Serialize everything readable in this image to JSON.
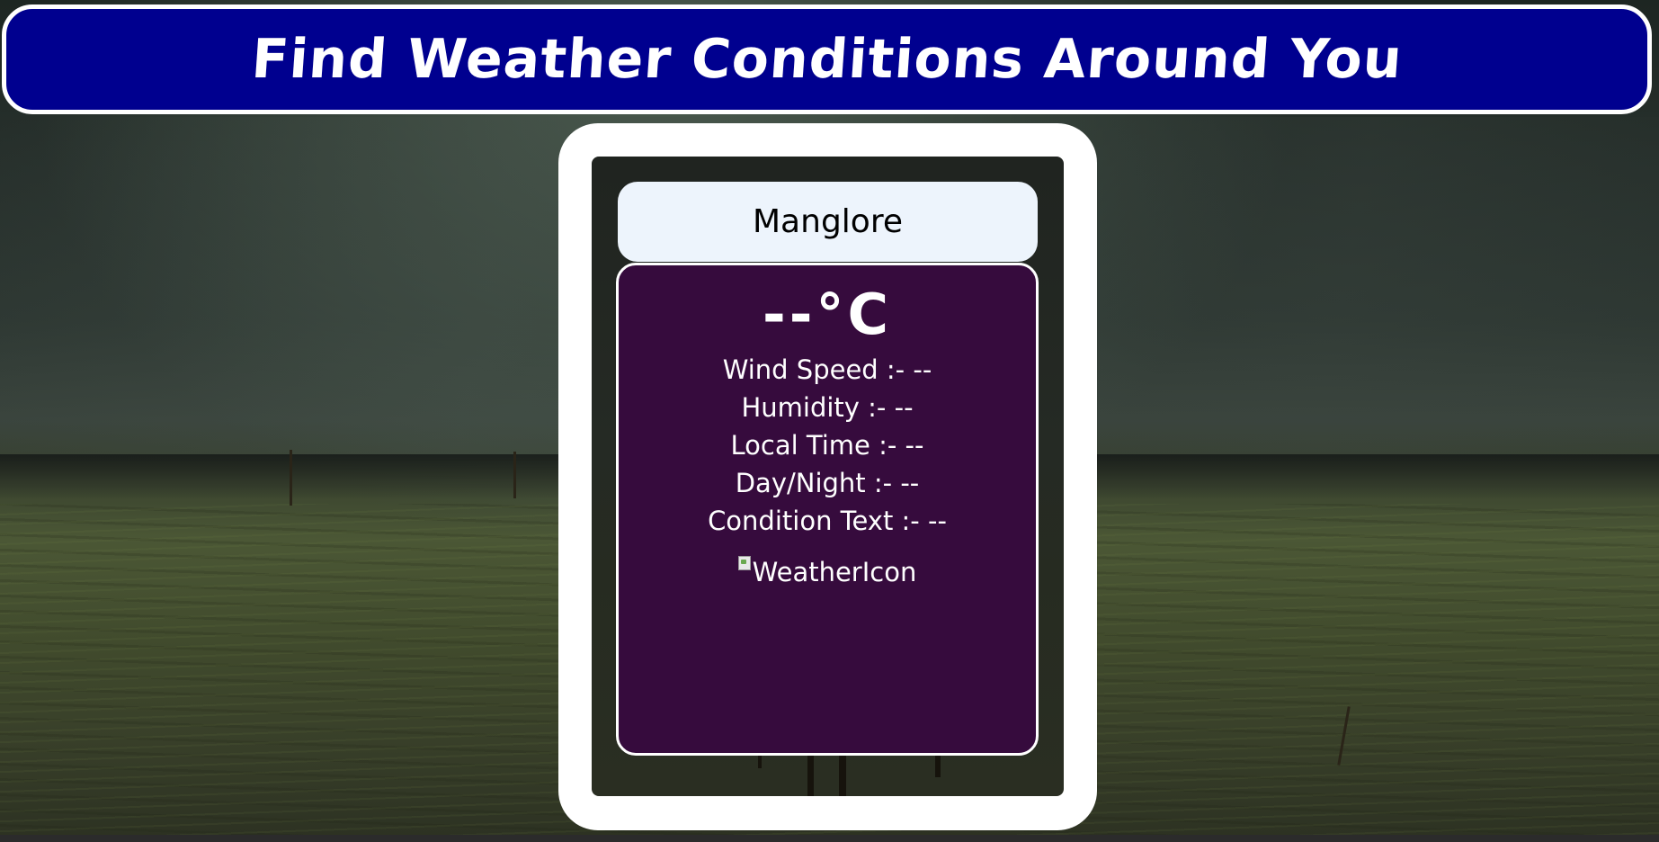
{
  "header": {
    "title": "Find Weather Conditions Around You"
  },
  "search": {
    "city_value": "Manglore"
  },
  "weather": {
    "temperature": "--°C",
    "rows": [
      "Wind Speed :- --",
      "Humidity :- --",
      "Local Time :- --",
      "Day/Night :- --",
      "Condition Text :- --"
    ],
    "icon_alt": "WeatherIcon"
  },
  "colors": {
    "header_bg": "#00008f",
    "info_bg": "#360b3d",
    "city_bg": "#edf4fc"
  }
}
